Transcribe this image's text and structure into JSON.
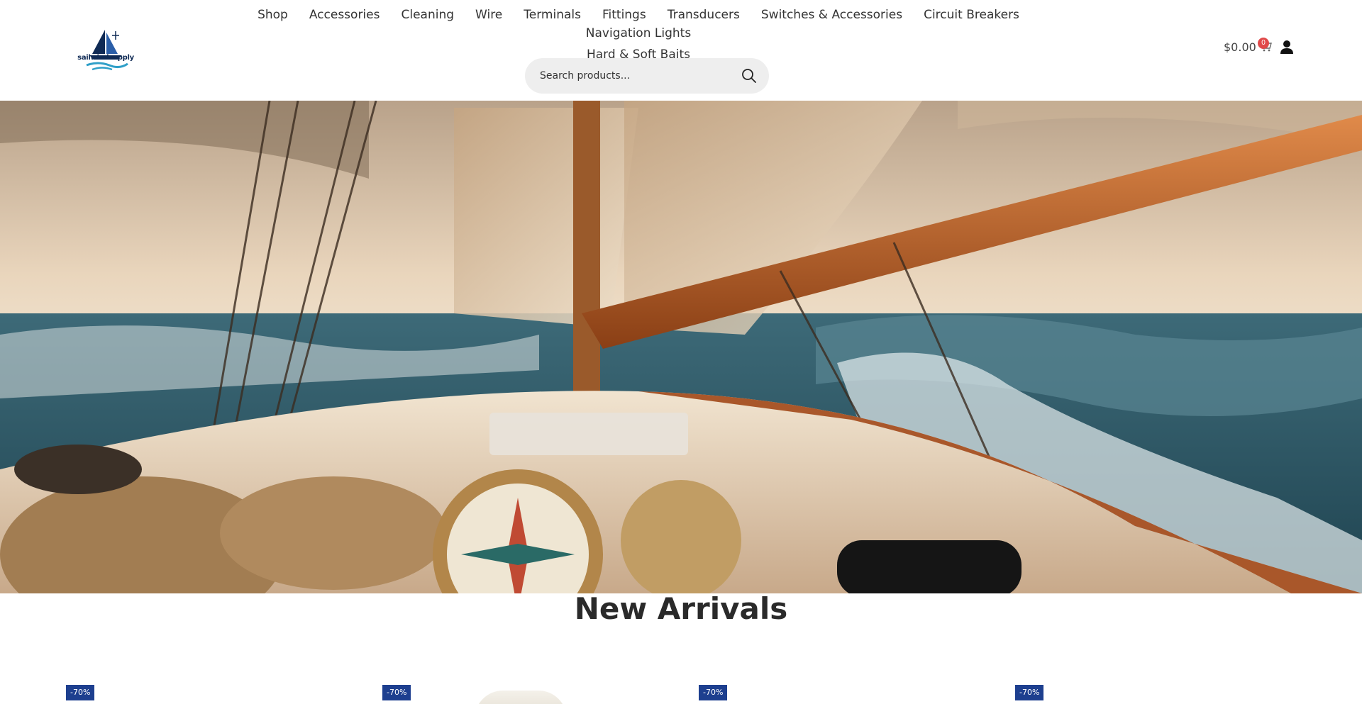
{
  "brand": {
    "logo_text": "sailwindsupply"
  },
  "nav": {
    "items": [
      "Shop",
      "Accessories",
      "Cleaning",
      "Wire",
      "Terminals",
      "Fittings",
      "Transducers",
      "Switches & Accessories",
      "Circuit Breakers",
      "Navigation Lights",
      "Hard & Soft Baits"
    ]
  },
  "search": {
    "placeholder": "Search products..."
  },
  "cart": {
    "total": "$0.00",
    "count": "0"
  },
  "section": {
    "title": "New Arrivals"
  },
  "products": [
    {
      "discount": "-70%"
    },
    {
      "discount": "-70%"
    },
    {
      "discount": "-70%"
    },
    {
      "discount": "-70%"
    }
  ],
  "colors": {
    "badge": "#1d3f8f",
    "cart_badge": "#e04a4a",
    "search_bg": "#eeeeee"
  }
}
